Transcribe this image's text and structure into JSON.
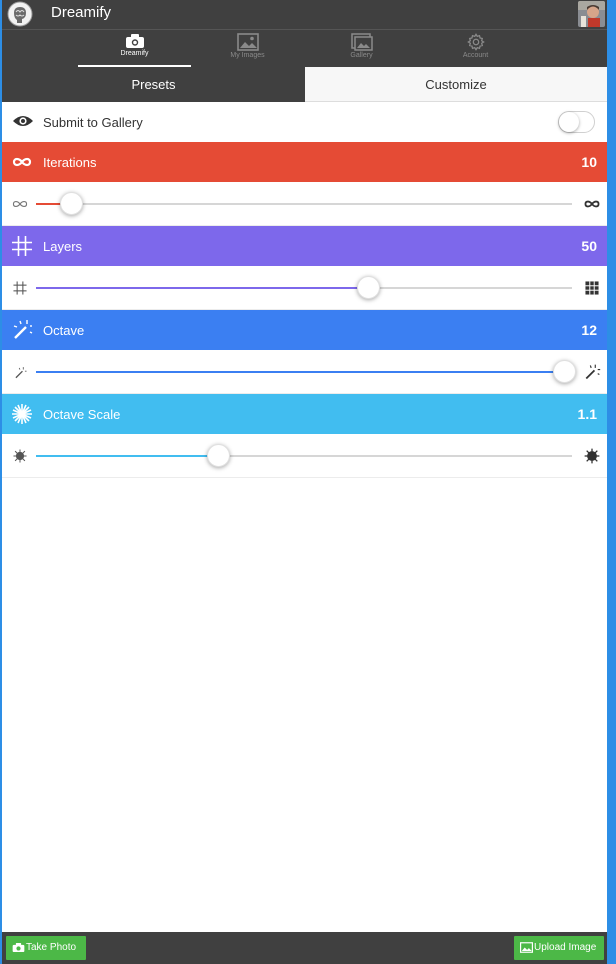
{
  "app": {
    "title": "Dreamify"
  },
  "nav_tabs": [
    {
      "label": "Dreamify",
      "icon": "camera-icon",
      "active": true
    },
    {
      "label": "My Images",
      "icon": "image-icon",
      "active": false
    },
    {
      "label": "Gallery",
      "icon": "gallery-icon",
      "active": false
    },
    {
      "label": "Account",
      "icon": "gear-icon",
      "active": false
    }
  ],
  "segments": {
    "presets": "Presets",
    "customize": "Customize"
  },
  "submit": {
    "label": "Submit to Gallery",
    "enabled": false
  },
  "params": [
    {
      "name": "Iterations",
      "value": "10",
      "color": "#e54b35",
      "icon": "infinity-icon",
      "position": 0.065
    },
    {
      "name": "Layers",
      "value": "50",
      "color": "#7d68eb",
      "icon": "grid-icon",
      "position": 0.62
    },
    {
      "name": "Octave",
      "value": "12",
      "color": "#3b7ff2",
      "icon": "magic-wand-icon",
      "position": 0.985
    },
    {
      "name": "Octave Scale",
      "value": "1.1",
      "color": "#41bdf0",
      "icon": "snowflake-icon",
      "position": 0.34
    }
  ],
  "bottom": {
    "take_photo": "Take Photo",
    "upload_image": "Upload Image",
    "button_color": "#4cb847"
  },
  "colors": {
    "bar": "#404040",
    "frame": "#2d8ee6"
  }
}
